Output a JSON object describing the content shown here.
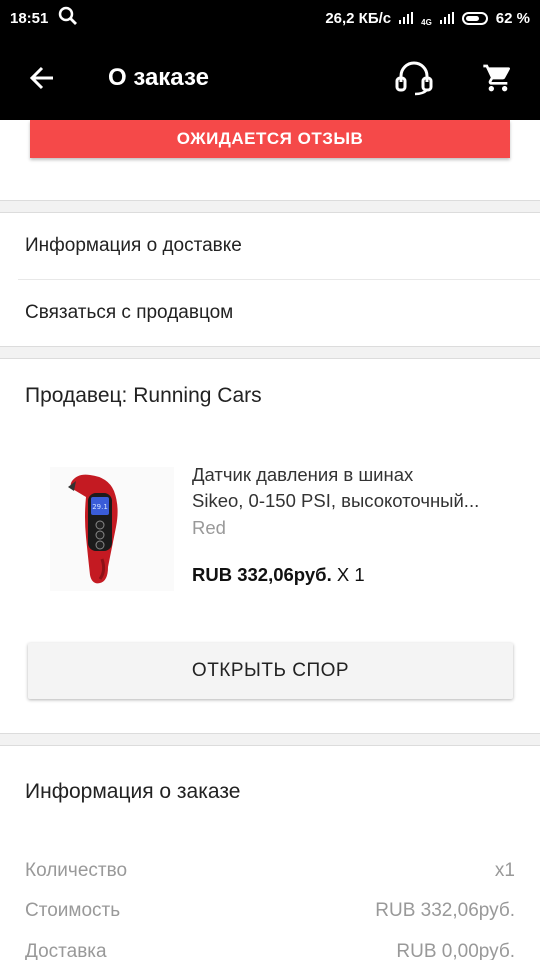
{
  "status_bar": {
    "time": "18:51",
    "speed": "26,2 КБ/с",
    "network": "4G",
    "battery": "62 %"
  },
  "app_bar": {
    "title": "О заказе",
    "icons": [
      "arrow-back-icon",
      "headset-icon",
      "cart-icon"
    ]
  },
  "review_button": "ОЖИДАЕТСЯ ОТЗЫВ",
  "links": {
    "delivery_info": "Информация о доставке",
    "contact_seller": "Связаться с продавцом"
  },
  "seller": {
    "title": "Продавец: Running Cars"
  },
  "product": {
    "name_line1": "Датчик давления в шинах",
    "name_line2": "Sikeo, 0-150 PSI, высокоточный...",
    "variant": "Red",
    "price": "RUB 332,06руб.",
    "quantity": " X 1"
  },
  "dispute_button": "ОТКРЫТЬ СПОР",
  "order_info": {
    "title": "Информация о заказе",
    "rows": [
      {
        "label": "Количество",
        "value": "x1"
      },
      {
        "label": "Стоимость",
        "value": "RUB 332,06руб."
      },
      {
        "label": "Доставка",
        "value": "RUB 0,00руб."
      }
    ]
  },
  "colors": {
    "accent_red": "#f54949",
    "app_bar": "#000000"
  }
}
